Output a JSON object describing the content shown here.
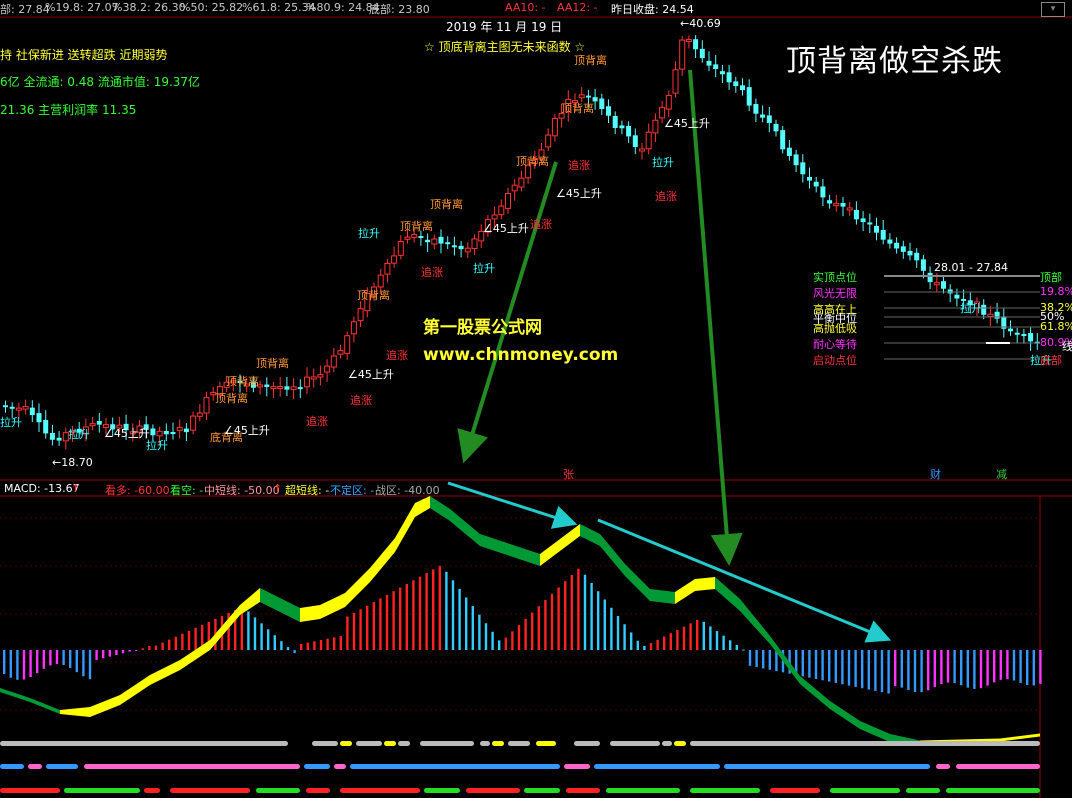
{
  "top_bar": {
    "fib_values": [
      "部: 27.84",
      "%19.8: 27.07",
      "%38.2: 26.30",
      "%50: 25.82",
      "%61.8: 25.34",
      "%80.9: 24.84",
      "底部: 23.80"
    ],
    "aa10": "AA10: -",
    "aa12": "AA12: -",
    "prev_close": "昨日收盘: 24.54"
  },
  "info": {
    "line1": "持 社保新进 送转超跌 近期弱势",
    "line2": "6亿 全流通: 0.48 流通市值: 19.37亿",
    "line3": "21.36 主营利润率 11.35"
  },
  "date": "2019 年 11 月 19 日",
  "banner": "☆ 顶底背离主图无未来函数 ☆",
  "big_title": "顶背离做空杀跌",
  "watermark": {
    "name": "第一股票公式网",
    "url": "www.chnmoney.com"
  },
  "price_marks": {
    "high": "←40.69",
    "low": "←18.70",
    "range": "28.01 - 27.84"
  },
  "candle_labels": [
    {
      "text": "顶背离",
      "type": "top"
    },
    {
      "text": "顶背离",
      "type": "top"
    },
    {
      "text": "顶背离",
      "type": "top"
    },
    {
      "text": "顶背离",
      "type": "top"
    },
    {
      "text": "顶背离",
      "type": "top"
    },
    {
      "text": "顶背离",
      "type": "top"
    },
    {
      "text": "顶背离",
      "type": "top"
    },
    {
      "text": "顶背离",
      "type": "top"
    },
    {
      "text": "顶背离",
      "type": "top"
    },
    {
      "text": "底背离",
      "type": "top"
    },
    {
      "text": "追涨",
      "type": "red"
    },
    {
      "text": "追涨",
      "type": "red"
    },
    {
      "text": "追涨",
      "type": "red"
    },
    {
      "text": "追涨",
      "type": "red"
    },
    {
      "text": "追涨",
      "type": "red"
    },
    {
      "text": "追涨",
      "type": "red"
    },
    {
      "text": "追涨",
      "type": "red"
    },
    {
      "text": "拉升",
      "type": "cyan"
    },
    {
      "text": "拉升",
      "type": "cyan"
    },
    {
      "text": "拉升",
      "type": "cyan"
    },
    {
      "text": "拉升",
      "type": "cyan"
    },
    {
      "text": "拉升",
      "type": "cyan"
    },
    {
      "text": "拉升",
      "type": "cyan"
    },
    {
      "text": "拉升",
      "type": "cyan"
    },
    {
      "text": "拉升",
      "type": "cyan"
    },
    {
      "text": "∠45上升",
      "type": "white"
    },
    {
      "text": "∠45上升",
      "type": "white"
    },
    {
      "text": "∠45上升",
      "type": "white"
    },
    {
      "text": "∠45上升",
      "type": "white"
    },
    {
      "text": "∠45上升",
      "type": "white"
    },
    {
      "text": "∠45上升",
      "type": "white"
    }
  ],
  "levels": {
    "left": [
      {
        "text": "实顶点位",
        "color": "#33ff33"
      },
      {
        "text": "风光无限",
        "color": "#ff33ff"
      },
      {
        "text": "高高在上",
        "color": "#ffff33"
      },
      {
        "text": "平衡中位",
        "color": "#ffffff"
      },
      {
        "text": "高抛低吸",
        "color": "#ffff33"
      },
      {
        "text": "耐心等待",
        "color": "#ff33ff"
      },
      {
        "text": "启动点位",
        "color": "#ff3333"
      }
    ],
    "right": [
      {
        "text": "顶部",
        "color": "#33ff33"
      },
      {
        "text": "19.8%",
        "color": "#ff33ff"
      },
      {
        "text": "38.2%",
        "color": "#ffff33"
      },
      {
        "text": "50%",
        "color": "#ffffff"
      },
      {
        "text": "61.8%",
        "color": "#ffff33"
      },
      {
        "text": "80.9%",
        "color": "#ff33ff"
      },
      {
        "text": "底部",
        "color": "#ff3333"
      }
    ],
    "side_char": "线"
  },
  "markers": [
    {
      "text": "张",
      "color": "#ff3333"
    },
    {
      "text": "财",
      "color": "#3399ff"
    },
    {
      "text": "减",
      "color": "#33cc33"
    }
  ],
  "indicator": {
    "macd": "MACD: -13.67",
    "kanduo": "看多: -60.00",
    "kankong": "看空: -",
    "zhongduan": "中短线: -50.00",
    "chaoduan": "超短线: -",
    "buding": "不定区: -",
    "zhanqu": "战区: -40.00"
  },
  "chart_data": {
    "type": "candlestick",
    "y_range": [
      18.7,
      40.69
    ],
    "high": 40.69,
    "low": 18.7,
    "fib_levels": {
      "top": 27.84,
      "p19_8": 27.07,
      "p38_2": 26.3,
      "p50": 25.82,
      "p61_8": 25.34,
      "p80_9": 24.84,
      "bottom": 23.8
    }
  },
  "colors": {
    "up": "#ff3333",
    "down": "#55ffff",
    "yellow_band": "#ffff00",
    "green_band": "#009933",
    "arrow_green": "#228b22",
    "arrow_cyan": "#22cccc"
  }
}
